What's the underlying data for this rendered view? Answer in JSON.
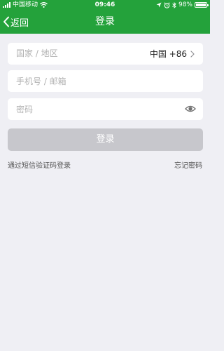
{
  "status_bar": {
    "carrier": "中国移动",
    "time": "09:46",
    "battery": "98%",
    "battery_level": 0.98,
    "icons": [
      "signal-icon",
      "wifi-icon",
      "location-icon",
      "alarm-icon",
      "bluetooth-icon",
      "battery-icon"
    ]
  },
  "nav": {
    "back_label": "返回",
    "title": "登录"
  },
  "form": {
    "region": {
      "label": "国家 / 地区",
      "value": "中国 +86"
    },
    "account": {
      "placeholder": "手机号 / 邮箱"
    },
    "password": {
      "placeholder": "密码"
    },
    "login_button": "登录"
  },
  "links": {
    "sms_login": "通过短信验证码登录",
    "forgot_password": "忘记密码"
  },
  "colors": {
    "header": "#24a23b",
    "background": "#efeff4",
    "disabled_button": "#c7c7cc"
  }
}
